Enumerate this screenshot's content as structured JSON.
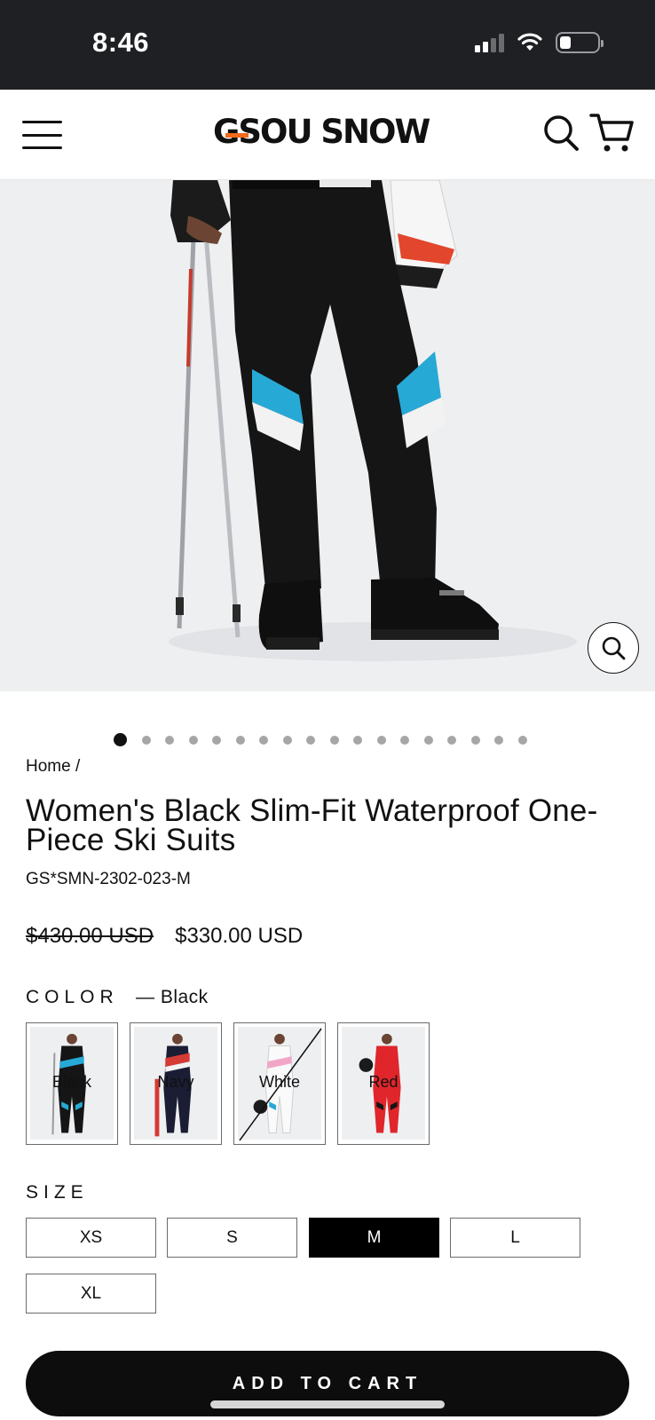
{
  "status_bar": {
    "time": "8:46"
  },
  "header": {
    "logo_text": "GSOU SNOW",
    "menu_icon": "hamburger-menu-icon",
    "search_icon": "search-icon",
    "cart_icon": "cart-icon"
  },
  "gallery": {
    "zoom_icon": "zoom-icon",
    "total_images": 18,
    "active_index": 0
  },
  "breadcrumb": {
    "home": "Home",
    "separator": "/"
  },
  "product": {
    "title": "Women's Black Slim-Fit Waterproof One-Piece Ski Suits",
    "sku": "GS*SMN-2302-023-M",
    "compare_price": "$430.00 USD",
    "price": "$330.00 USD"
  },
  "color": {
    "label": "COLOR",
    "selected": "— Black",
    "options": [
      {
        "label": "Black",
        "available": true
      },
      {
        "label": "Navy",
        "available": true
      },
      {
        "label": "White",
        "available": false
      },
      {
        "label": "Red",
        "available": true
      }
    ]
  },
  "size": {
    "label": "SIZE",
    "options": [
      "XS",
      "S",
      "M",
      "L",
      "XL"
    ],
    "selected": "M"
  },
  "cart": {
    "add_label": "ADD TO CART"
  },
  "colors": {
    "accent": "#f26a1b",
    "suit_blue": "#27a9d6",
    "button_bg": "#0d0d0d"
  }
}
